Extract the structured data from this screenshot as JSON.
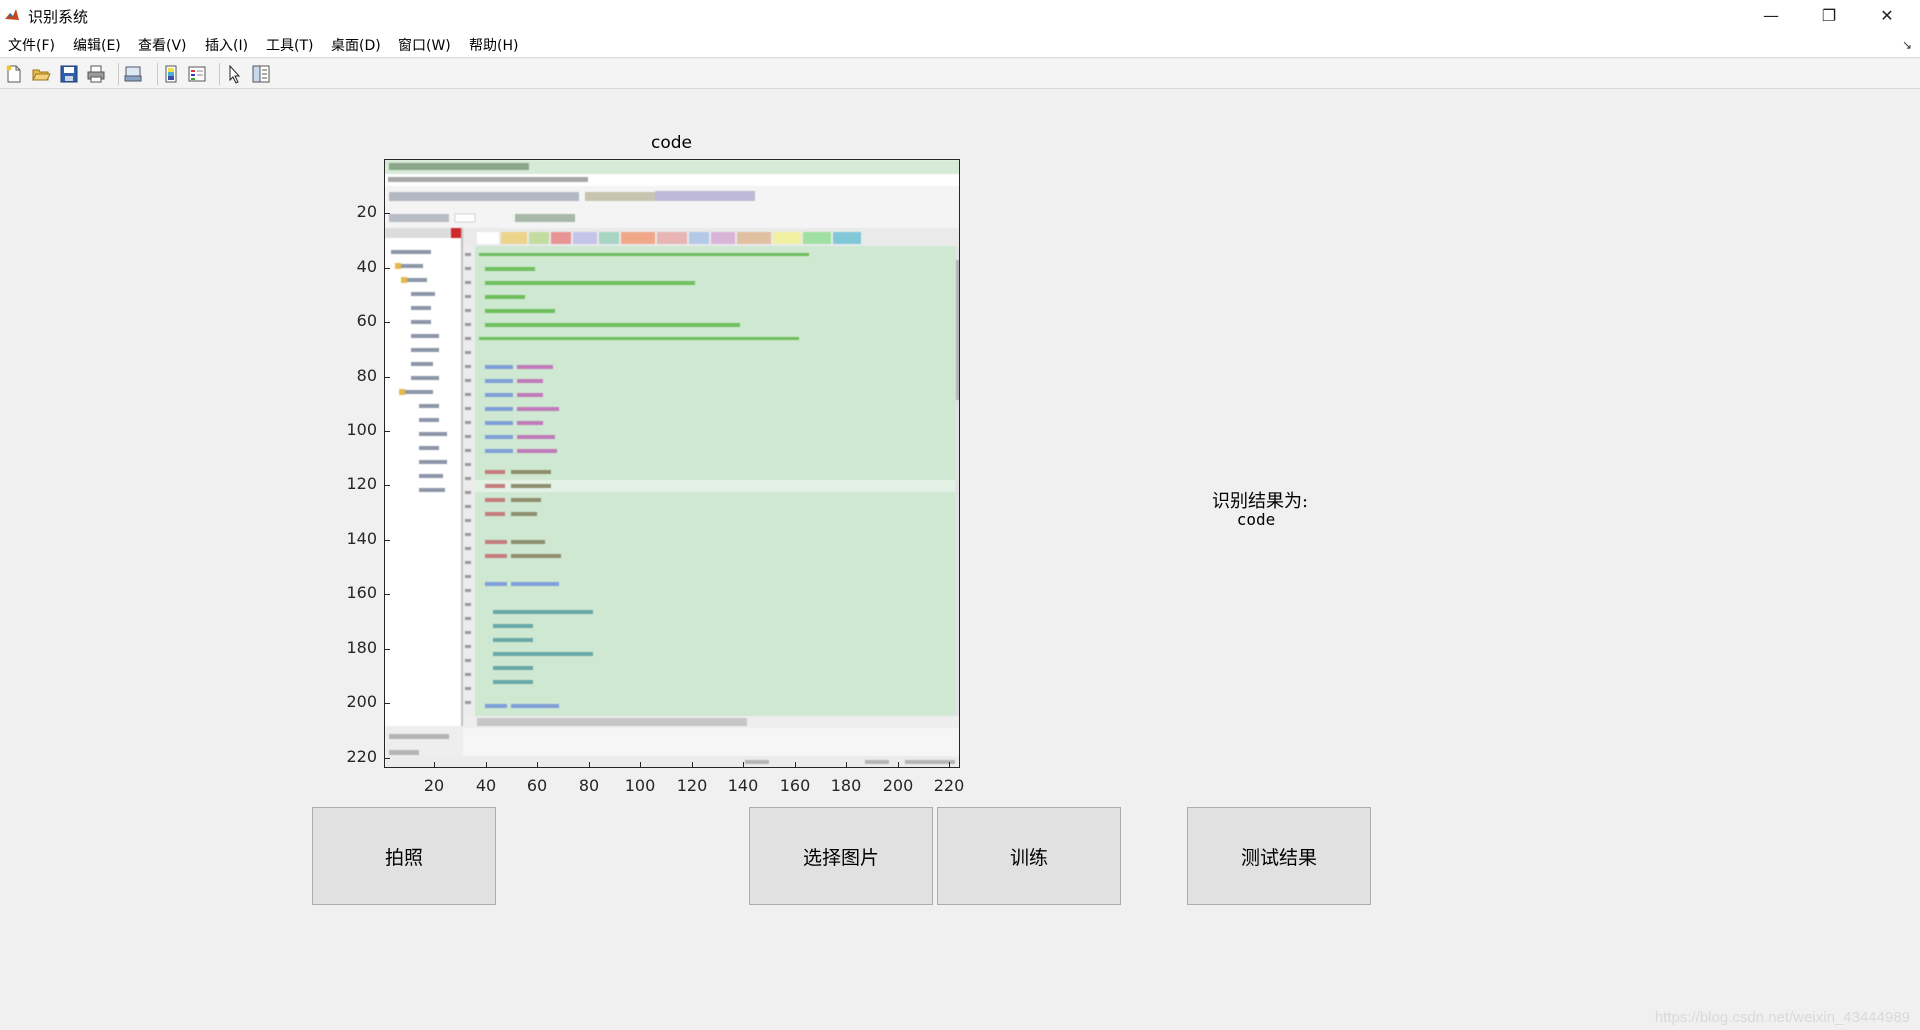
{
  "window": {
    "title": "识别系统",
    "controls": {
      "minimize": "—",
      "restore": "❐",
      "close": "✕"
    }
  },
  "menu": {
    "items": [
      "文件(F)",
      "编辑(E)",
      "查看(V)",
      "插入(I)",
      "工具(T)",
      "桌面(D)",
      "窗口(W)",
      "帮助(H)"
    ],
    "dock_arrow": "↘"
  },
  "toolbar": {
    "icons": [
      "new-file-icon",
      "open-folder-icon",
      "save-icon",
      "print-icon",
      "print-preview-icon",
      "colorbar-icon",
      "legend-icon",
      "pointer-icon",
      "property-inspector-icon"
    ]
  },
  "axes": {
    "title": "code",
    "yticks": [
      "20",
      "40",
      "60",
      "80",
      "100",
      "120",
      "140",
      "160",
      "180",
      "200",
      "220"
    ],
    "xticks": [
      "20",
      "40",
      "60",
      "80",
      "100",
      "120",
      "140",
      "160",
      "180",
      "200",
      "220"
    ]
  },
  "result": {
    "label": "识别结果为:",
    "value": "code"
  },
  "buttons": {
    "capture": "拍照",
    "select_image": "选择图片",
    "train": "训练",
    "test_result": "测试结果"
  },
  "watermark": "https://blog.csdn.net/weixin_43444989",
  "colors": {
    "code_background": "#cfe8d2",
    "button_face": "#e1e1e1",
    "figure_background": "#f0f0f0"
  }
}
